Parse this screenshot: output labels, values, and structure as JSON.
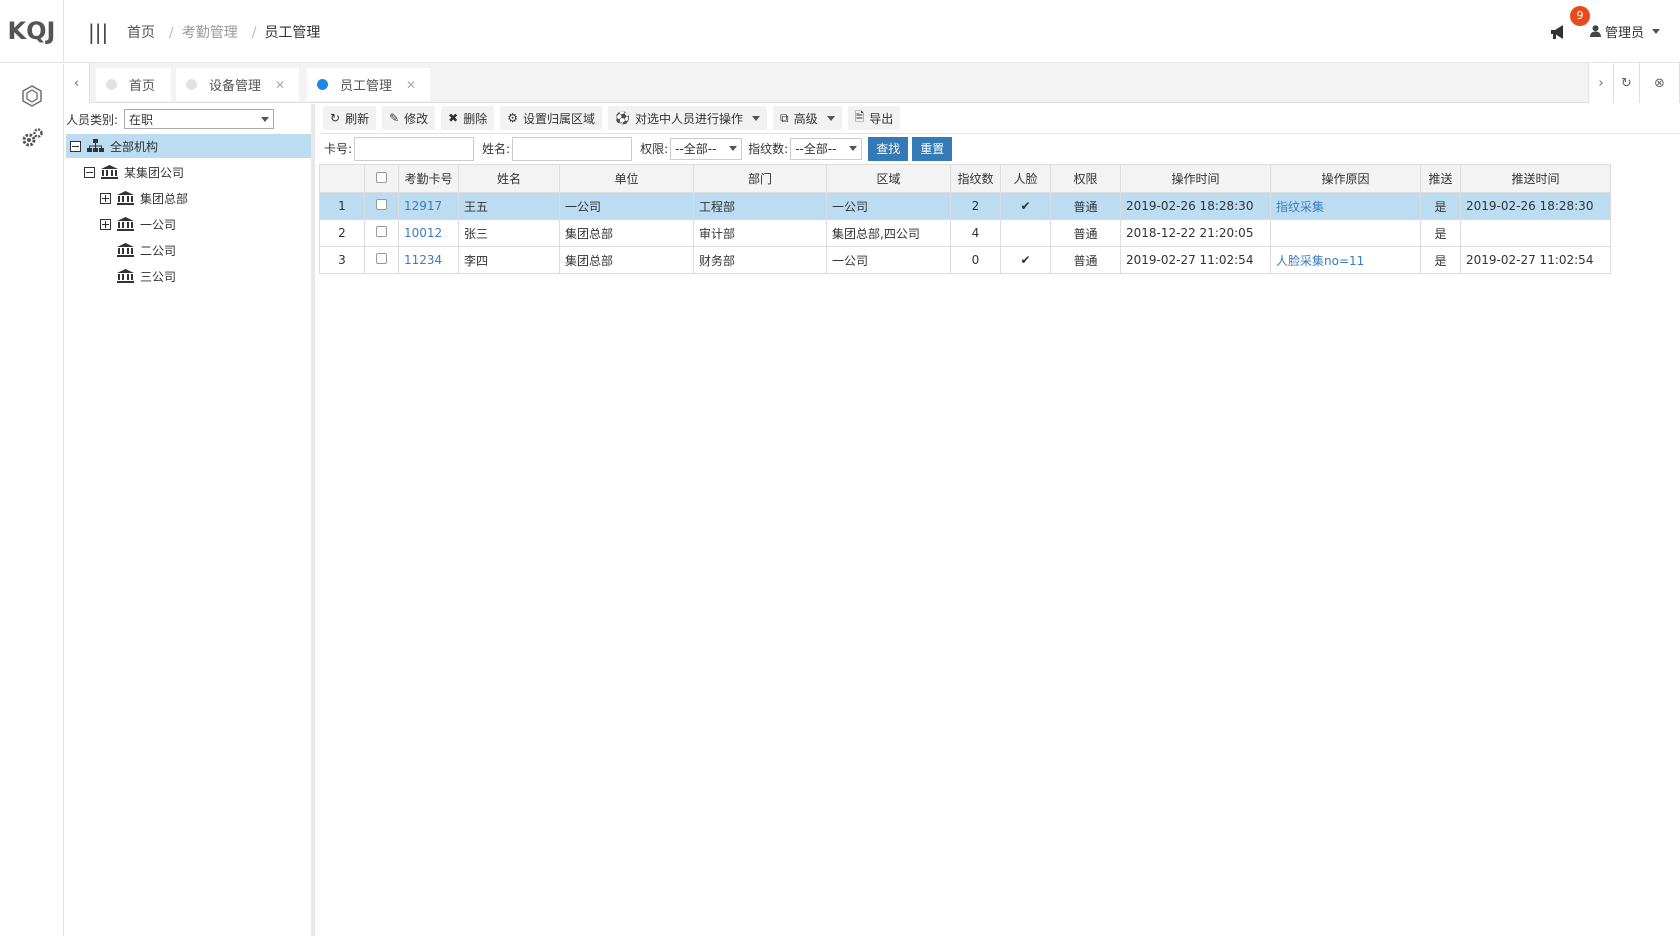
{
  "app": {
    "logo": "KQJ"
  },
  "breadcrumb": {
    "home": "首页",
    "section": "考勤管理",
    "current": "员工管理"
  },
  "header": {
    "notification_count": "9",
    "user_label": "管理员"
  },
  "tabs": [
    {
      "label": "首页"
    },
    {
      "label": "设备管理"
    },
    {
      "label": "员工管理"
    }
  ],
  "tree": {
    "category_label": "人员类别:",
    "category_value": "在职",
    "root": "全部机构",
    "group": "某集团公司",
    "children": [
      "集团总部",
      "一公司",
      "二公司",
      "三公司"
    ]
  },
  "toolbar": {
    "refresh": "刷新",
    "edit": "修改",
    "delete": "删除",
    "set_area": "设置归属区域",
    "batch_ops": "对选中人员进行操作",
    "advanced": "高级",
    "export": "导出"
  },
  "search": {
    "card_label": "卡号:",
    "name_label": "姓名:",
    "perm_label": "权限:",
    "perm_value": "--全部--",
    "fp_label": "指纹数:",
    "fp_value": "--全部--",
    "search_btn": "查找",
    "reset_btn": "重置"
  },
  "table": {
    "headers": [
      "考勤卡号",
      "姓名",
      "单位",
      "部门",
      "区域",
      "指纹数",
      "人脸",
      "权限",
      "操作时间",
      "操作原因",
      "推送",
      "推送时间"
    ],
    "rows": [
      {
        "no": "1",
        "card": "12917",
        "name": "王五",
        "unit": "一公司",
        "dept": "工程部",
        "area": "一公司",
        "fp": "2",
        "face": "✔",
        "perm": "普通",
        "op_time": "2019-02-26 18:28:30",
        "reason": "指纹采集",
        "push": "是",
        "push_time": "2019-02-26 18:28:30"
      },
      {
        "no": "2",
        "card": "10012",
        "name": "张三",
        "unit": "集团总部",
        "dept": "审计部",
        "area": "集团总部,四公司",
        "fp": "4",
        "face": "",
        "perm": "普通",
        "op_time": "2018-12-22 21:20:05",
        "reason": "",
        "push": "是",
        "push_time": ""
      },
      {
        "no": "3",
        "card": "11234",
        "name": "李四",
        "unit": "集团总部",
        "dept": "财务部",
        "area": "一公司",
        "fp": "0",
        "face": "✔",
        "perm": "普通",
        "op_time": "2019-02-27 11:02:54",
        "reason": "人脸采集no=11",
        "push": "是",
        "push_time": "2019-02-27 11:02:54"
      }
    ]
  }
}
